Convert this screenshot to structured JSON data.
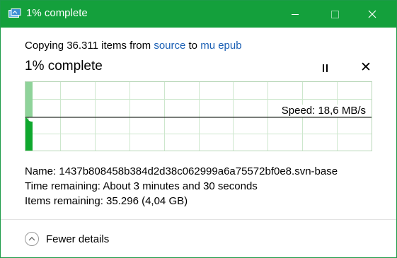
{
  "window": {
    "title": "1% complete",
    "accent_color": "#14a03c",
    "title_icon": "file-copy-icon"
  },
  "copy_summary": {
    "prefix": "Copying 36.311 items from ",
    "source_link": "source",
    "middle": " to ",
    "destination_link": "mu epub"
  },
  "progress": {
    "heading": "1% complete",
    "percent": 1,
    "pause_icon": "pause-icon",
    "cancel_icon": "close-icon",
    "cancel_glyph": "✕"
  },
  "graph": {
    "speed_label": "Speed: 18,6 MB/s",
    "fill_color": "#0fa82e",
    "grid_color": "#cde7cd"
  },
  "details": {
    "name": "Name:  1437b808458b384d2d38c062999a6a75572bf0e8.svn-base",
    "time_remaining": "Time remaining:  About 3 minutes and 30 seconds",
    "items_remaining": "Items remaining:  35.296 (4,04 GB)"
  },
  "footer": {
    "toggle_label": "Fewer details",
    "toggle_icon": "chevron-up-icon"
  }
}
